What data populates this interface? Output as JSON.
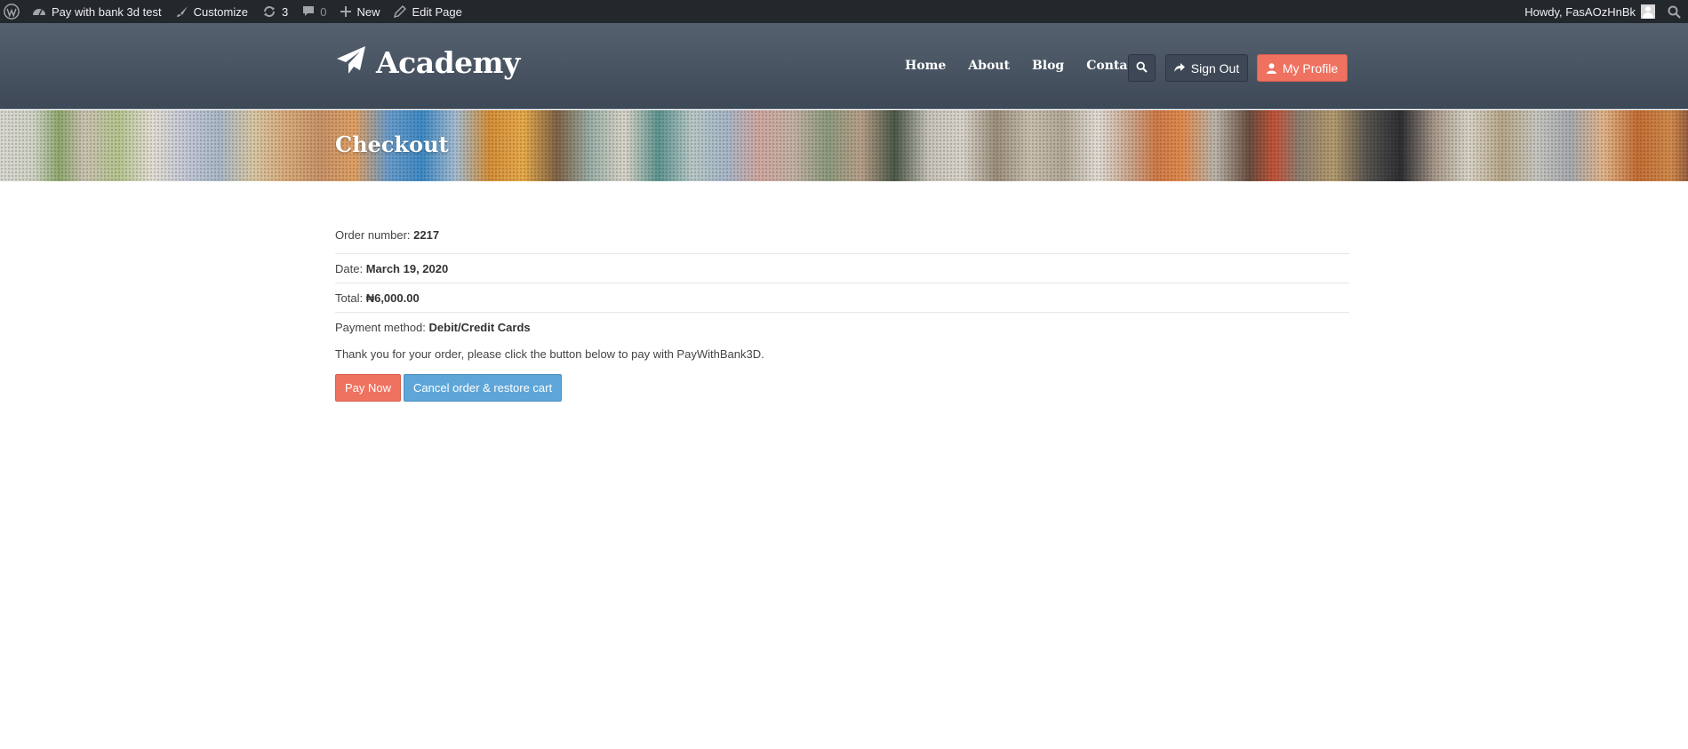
{
  "adminbar": {
    "site_name": "Pay with bank 3d test",
    "customize_label": "Customize",
    "updates_count": "3",
    "comments_count": "0",
    "new_label": "New",
    "edit_page_label": "Edit Page",
    "howdy_text": "Howdy, FasAOzHnBk"
  },
  "header": {
    "logo_text": "Academy",
    "nav": [
      "Home",
      "About",
      "Blog",
      "Contact"
    ],
    "sign_out_label": "Sign Out",
    "my_profile_label": "My Profile"
  },
  "page": {
    "title": "Checkout"
  },
  "order": {
    "number_label": "Order number:",
    "number_value": "2217",
    "date_label": "Date:",
    "date_value": "March 19, 2020",
    "total_label": "Total:",
    "total_value": "₦6,000.00",
    "payment_label": "Payment method:",
    "payment_value": "Debit/Credit Cards",
    "thanks_text": "Thank you for your order, please click the button below to pay with PayWithBank3D."
  },
  "actions": {
    "pay_now_label": "Pay Now",
    "cancel_label": "Cancel order & restore cart"
  },
  "colors": {
    "adminbar_bg": "#23282d",
    "header_bg": "#4a5563",
    "accent_coral": "#ef7160",
    "accent_blue": "#5fa6d8"
  }
}
